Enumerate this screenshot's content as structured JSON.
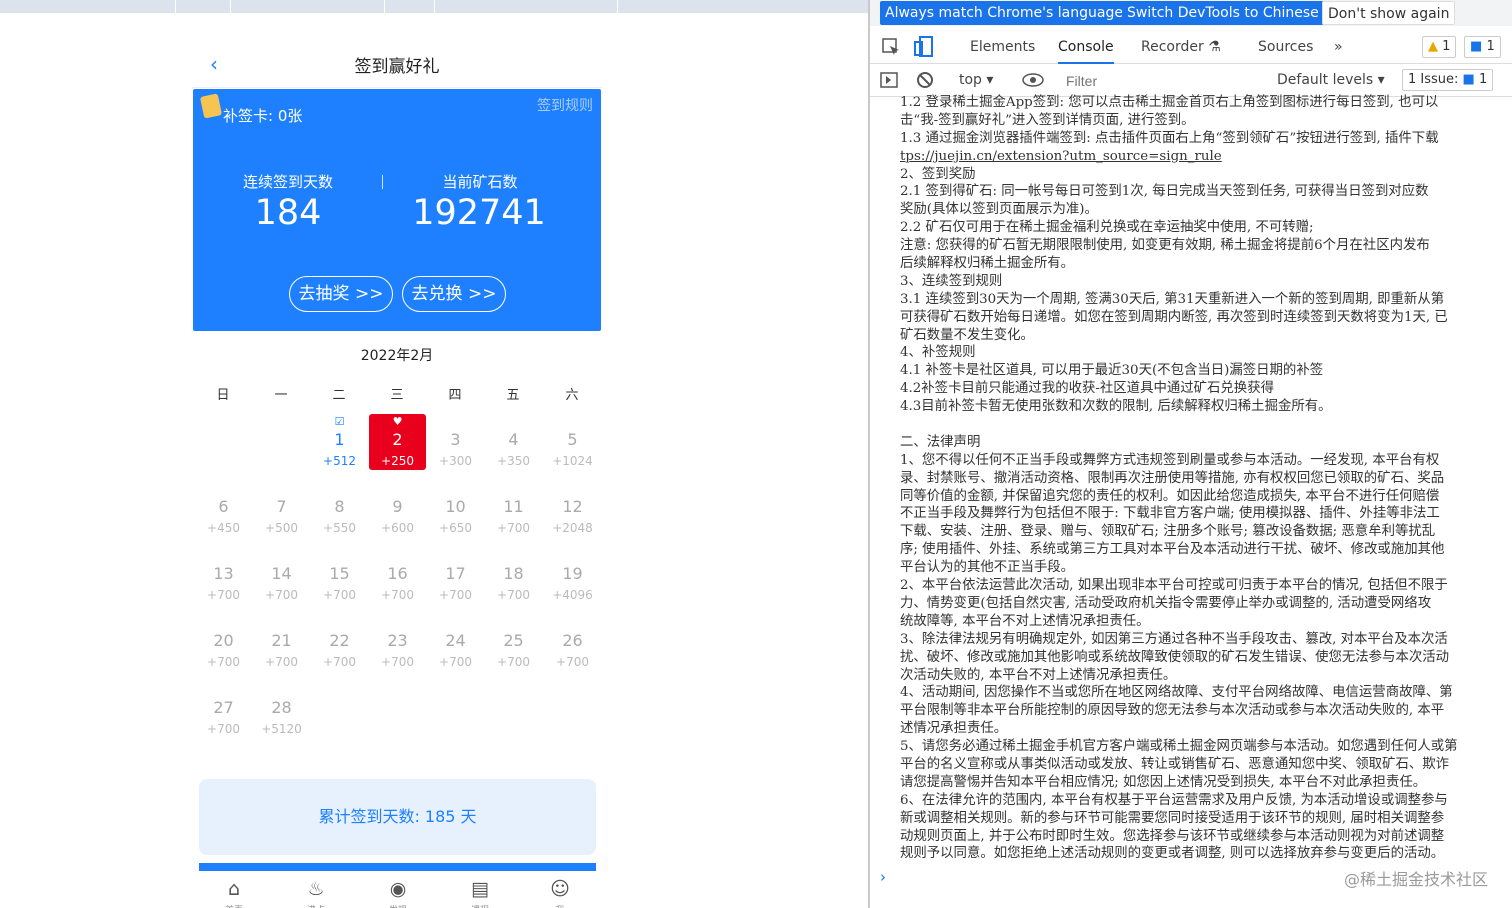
{
  "page": {
    "title": "签到赢好礼",
    "back_icon": "‹"
  },
  "banner": {
    "makeup_card": "补签卡: 0张",
    "rules_link": "签到规则",
    "streak_label": "连续签到天数",
    "streak_value": "184",
    "ore_label": "当前矿石数",
    "ore_value": "192741",
    "lottery_button": "去抽奖 >>",
    "exchange_button": "去兑换 >>"
  },
  "calendar": {
    "month": "2022年2月",
    "weekdays": [
      "日",
      "一",
      "二",
      "三",
      "四",
      "五",
      "六"
    ],
    "days": [
      {
        "d": "1",
        "p": "+512",
        "state": "done"
      },
      {
        "d": "2",
        "p": "+250",
        "state": "today"
      },
      {
        "d": "3",
        "p": "+300"
      },
      {
        "d": "4",
        "p": "+350"
      },
      {
        "d": "5",
        "p": "+1024"
      },
      {
        "d": "6",
        "p": "+450"
      },
      {
        "d": "7",
        "p": "+500"
      },
      {
        "d": "8",
        "p": "+550"
      },
      {
        "d": "9",
        "p": "+600"
      },
      {
        "d": "10",
        "p": "+650"
      },
      {
        "d": "11",
        "p": "+700"
      },
      {
        "d": "12",
        "p": "+2048"
      },
      {
        "d": "13",
        "p": "+700"
      },
      {
        "d": "14",
        "p": "+700"
      },
      {
        "d": "15",
        "p": "+700"
      },
      {
        "d": "16",
        "p": "+700"
      },
      {
        "d": "17",
        "p": "+700"
      },
      {
        "d": "18",
        "p": "+700"
      },
      {
        "d": "19",
        "p": "+4096"
      },
      {
        "d": "20",
        "p": "+700"
      },
      {
        "d": "21",
        "p": "+700"
      },
      {
        "d": "22",
        "p": "+700"
      },
      {
        "d": "23",
        "p": "+700"
      },
      {
        "d": "24",
        "p": "+700"
      },
      {
        "d": "25",
        "p": "+700"
      },
      {
        "d": "26",
        "p": "+700"
      },
      {
        "d": "27",
        "p": "+700"
      },
      {
        "d": "28",
        "p": "+5120"
      }
    ],
    "first_weekday": 2,
    "done_icon": "☑",
    "today_icon": "♥",
    "total": "累计签到天数: 185 天"
  },
  "tabs": [
    {
      "icon": "⌂",
      "label": "首页"
    },
    {
      "icon": "♨",
      "label": "沸点"
    },
    {
      "icon": "◉",
      "label": "发现"
    },
    {
      "icon": "▤",
      "label": "课程"
    },
    {
      "icon": "☺",
      "label": "我"
    }
  ],
  "devtools": {
    "lang_bar": {
      "match": "Always match Chrome's language",
      "switch": "Switch DevTools to Chinese",
      "dont_show": "Don't show again"
    },
    "tabs": [
      "Elements",
      "Console",
      "Recorder ⚗",
      "Sources"
    ],
    "more_tabs": "»",
    "warnings": "1",
    "messages": "1",
    "console_bar": {
      "context": "top",
      "filter_placeholder": "Filter",
      "levels": "Default levels",
      "issues": "1 Issue:",
      "issues_count": "1"
    },
    "prompt": "›",
    "watermark": "@稀土掘金技术社区",
    "lines": [
      "1.2 登录稀土掘金App签到: 您可以点击稀土掘金首页右上角签到图标进行每日签到, 也可以",
      "击“我-签到赢好礼”进入签到详情页面, 进行签到。",
      "1.3 通过掘金浏览器插件端签到: 点击插件页面右上角“签到领矿石”按钮进行签到, 插件下载",
      "tps://juejin.cn/extension?utm_source=sign_rule",
      "2、签到奖励",
      "2.1 签到得矿石: 同一帐号每日可签到1次, 每日完成当天签到任务, 可获得当日签到对应数",
      "奖励(具体以签到页面展示为准)。",
      "2.2 矿石仅可用于在稀土掘金福利兑换或在幸运抽奖中使用, 不可转赠;",
      "注意: 您获得的矿石暂无期限限制使用, 如变更有效期, 稀土掘金将提前6个月在社区内发布",
      "后续解释权归稀土掘金所有。",
      "3、连续签到规则",
      "3.1 连续签到30天为一个周期, 签满30天后, 第31天重新进入一个新的签到周期, 即重新从第",
      "可获得矿石数开始每日递增。如您在签到周期内断签, 再次签到时连续签到天数将变为1天, 已",
      "矿石数量不发生变化。",
      "4、补签规则",
      "4.1 补签卡是社区道具, 可以用于最近30天(不包含当日)漏签日期的补签",
      "4.2补签卡目前只能通过我的收获-社区道具中通过矿石兑换获得",
      "4.3目前补签卡暂无使用张数和次数的限制, 后续解释权归稀土掘金所有。",
      "",
      "二、法律声明",
      "1、您不得以任何不正当手段或舞弊方式违规签到刷量或参与本活动。一经发现, 本平台有权",
      "录、封禁账号、撤消活动资格、限制再次注册使用等措施, 亦有权权回您已领取的矿石、奖品",
      "同等价值的金额, 并保留追究您的责任的权利。如因此给您造成损失, 本平台不进行任何赔偿",
      "不正当手段及舞弊行为包括但不限于: 下载非官方客户端; 使用模拟器、插件、外挂等非法工",
      "下载、安装、注册、登录、赠与、领取矿石; 注册多个账号; 篡改设备数据; 恶意牟利等扰乱",
      "序; 使用插件、外挂、系统或第三方工具对本平台及本活动进行干扰、破坏、修改或施加其他",
      "平台认为的其他不正当手段。",
      "2、本平台依法运营此次活动, 如果出现非本平台可控或可归责于本平台的情况, 包括但不限于",
      "力、情势变更(包括自然灾害, 活动受政府机关指令需要停止举办或调整的, 活动遭受网络攻",
      "统故障等, 本平台不对上述情况承担责任。",
      "3、除法律法规另有明确规定外, 如因第三方通过各种不当手段攻击、篡改, 对本平台及本次活",
      "扰、破坏、修改或施加其他影响或系统故障致使领取的矿石发生错误、使您无法参与本次活动",
      "次活动失败的, 本平台不对上述情况承担责任。",
      "4、活动期间, 因您操作不当或您所在地区网络故障、支付平台网络故障、电信运营商故障、第",
      "平台限制等非本平台所能控制的原因导致的您无法参与本次活动或参与本次活动失败的, 本平",
      "述情况承担责任。",
      "5、请您务必通过稀土掘金手机官方客户端或稀土掘金网页端参与本活动。如您遇到任何人或第",
      "平台的名义宣称或从事类似活动或发放、转让或销售矿石、恶意通知您中奖、领取矿石、欺诈",
      "请您提高警惕并告知本平台相应情况; 如您因上述情况受到损失, 本平台不对此承担责任。",
      "6、在法律允许的范围内, 本平台有权基于平台运营需求及用户反馈, 为本活动增设或调整参与",
      "新或调整相关规则。新的参与环节可能需要您同时接受适用于该环节的规则, 届时相关调整参",
      "动规则页面上, 并于公布时即时生效。您选择参与该环节或继续参与本活动则视为对前述调整",
      "规则予以同意。如您拒绝上述活动规则的变更或者调整, 则可以选择放弃参与变更后的活动。"
    ]
  }
}
